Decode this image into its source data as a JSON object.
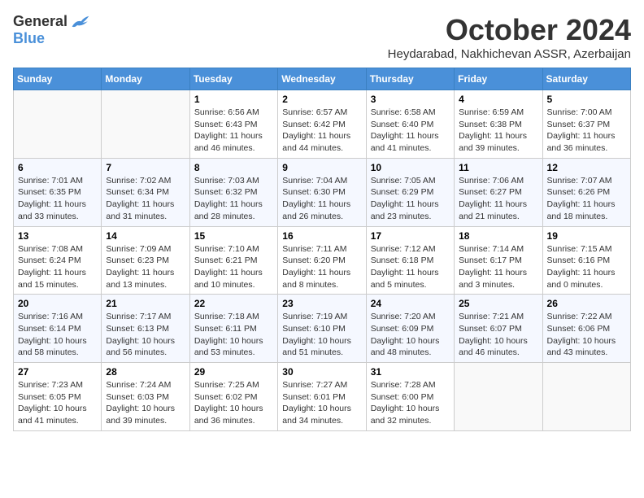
{
  "logo": {
    "general": "General",
    "blue": "Blue"
  },
  "title": "October 2024",
  "location": "Heydarabad, Nakhichevan ASSR, Azerbaijan",
  "headers": [
    "Sunday",
    "Monday",
    "Tuesday",
    "Wednesday",
    "Thursday",
    "Friday",
    "Saturday"
  ],
  "weeks": [
    [
      {
        "day": "",
        "sunrise": "",
        "sunset": "",
        "daylight": ""
      },
      {
        "day": "",
        "sunrise": "",
        "sunset": "",
        "daylight": ""
      },
      {
        "day": "1",
        "sunrise": "Sunrise: 6:56 AM",
        "sunset": "Sunset: 6:43 PM",
        "daylight": "Daylight: 11 hours and 46 minutes."
      },
      {
        "day": "2",
        "sunrise": "Sunrise: 6:57 AM",
        "sunset": "Sunset: 6:42 PM",
        "daylight": "Daylight: 11 hours and 44 minutes."
      },
      {
        "day": "3",
        "sunrise": "Sunrise: 6:58 AM",
        "sunset": "Sunset: 6:40 PM",
        "daylight": "Daylight: 11 hours and 41 minutes."
      },
      {
        "day": "4",
        "sunrise": "Sunrise: 6:59 AM",
        "sunset": "Sunset: 6:38 PM",
        "daylight": "Daylight: 11 hours and 39 minutes."
      },
      {
        "day": "5",
        "sunrise": "Sunrise: 7:00 AM",
        "sunset": "Sunset: 6:37 PM",
        "daylight": "Daylight: 11 hours and 36 minutes."
      }
    ],
    [
      {
        "day": "6",
        "sunrise": "Sunrise: 7:01 AM",
        "sunset": "Sunset: 6:35 PM",
        "daylight": "Daylight: 11 hours and 33 minutes."
      },
      {
        "day": "7",
        "sunrise": "Sunrise: 7:02 AM",
        "sunset": "Sunset: 6:34 PM",
        "daylight": "Daylight: 11 hours and 31 minutes."
      },
      {
        "day": "8",
        "sunrise": "Sunrise: 7:03 AM",
        "sunset": "Sunset: 6:32 PM",
        "daylight": "Daylight: 11 hours and 28 minutes."
      },
      {
        "day": "9",
        "sunrise": "Sunrise: 7:04 AM",
        "sunset": "Sunset: 6:30 PM",
        "daylight": "Daylight: 11 hours and 26 minutes."
      },
      {
        "day": "10",
        "sunrise": "Sunrise: 7:05 AM",
        "sunset": "Sunset: 6:29 PM",
        "daylight": "Daylight: 11 hours and 23 minutes."
      },
      {
        "day": "11",
        "sunrise": "Sunrise: 7:06 AM",
        "sunset": "Sunset: 6:27 PM",
        "daylight": "Daylight: 11 hours and 21 minutes."
      },
      {
        "day": "12",
        "sunrise": "Sunrise: 7:07 AM",
        "sunset": "Sunset: 6:26 PM",
        "daylight": "Daylight: 11 hours and 18 minutes."
      }
    ],
    [
      {
        "day": "13",
        "sunrise": "Sunrise: 7:08 AM",
        "sunset": "Sunset: 6:24 PM",
        "daylight": "Daylight: 11 hours and 15 minutes."
      },
      {
        "day": "14",
        "sunrise": "Sunrise: 7:09 AM",
        "sunset": "Sunset: 6:23 PM",
        "daylight": "Daylight: 11 hours and 13 minutes."
      },
      {
        "day": "15",
        "sunrise": "Sunrise: 7:10 AM",
        "sunset": "Sunset: 6:21 PM",
        "daylight": "Daylight: 11 hours and 10 minutes."
      },
      {
        "day": "16",
        "sunrise": "Sunrise: 7:11 AM",
        "sunset": "Sunset: 6:20 PM",
        "daylight": "Daylight: 11 hours and 8 minutes."
      },
      {
        "day": "17",
        "sunrise": "Sunrise: 7:12 AM",
        "sunset": "Sunset: 6:18 PM",
        "daylight": "Daylight: 11 hours and 5 minutes."
      },
      {
        "day": "18",
        "sunrise": "Sunrise: 7:14 AM",
        "sunset": "Sunset: 6:17 PM",
        "daylight": "Daylight: 11 hours and 3 minutes."
      },
      {
        "day": "19",
        "sunrise": "Sunrise: 7:15 AM",
        "sunset": "Sunset: 6:16 PM",
        "daylight": "Daylight: 11 hours and 0 minutes."
      }
    ],
    [
      {
        "day": "20",
        "sunrise": "Sunrise: 7:16 AM",
        "sunset": "Sunset: 6:14 PM",
        "daylight": "Daylight: 10 hours and 58 minutes."
      },
      {
        "day": "21",
        "sunrise": "Sunrise: 7:17 AM",
        "sunset": "Sunset: 6:13 PM",
        "daylight": "Daylight: 10 hours and 56 minutes."
      },
      {
        "day": "22",
        "sunrise": "Sunrise: 7:18 AM",
        "sunset": "Sunset: 6:11 PM",
        "daylight": "Daylight: 10 hours and 53 minutes."
      },
      {
        "day": "23",
        "sunrise": "Sunrise: 7:19 AM",
        "sunset": "Sunset: 6:10 PM",
        "daylight": "Daylight: 10 hours and 51 minutes."
      },
      {
        "day": "24",
        "sunrise": "Sunrise: 7:20 AM",
        "sunset": "Sunset: 6:09 PM",
        "daylight": "Daylight: 10 hours and 48 minutes."
      },
      {
        "day": "25",
        "sunrise": "Sunrise: 7:21 AM",
        "sunset": "Sunset: 6:07 PM",
        "daylight": "Daylight: 10 hours and 46 minutes."
      },
      {
        "day": "26",
        "sunrise": "Sunrise: 7:22 AM",
        "sunset": "Sunset: 6:06 PM",
        "daylight": "Daylight: 10 hours and 43 minutes."
      }
    ],
    [
      {
        "day": "27",
        "sunrise": "Sunrise: 7:23 AM",
        "sunset": "Sunset: 6:05 PM",
        "daylight": "Daylight: 10 hours and 41 minutes."
      },
      {
        "day": "28",
        "sunrise": "Sunrise: 7:24 AM",
        "sunset": "Sunset: 6:03 PM",
        "daylight": "Daylight: 10 hours and 39 minutes."
      },
      {
        "day": "29",
        "sunrise": "Sunrise: 7:25 AM",
        "sunset": "Sunset: 6:02 PM",
        "daylight": "Daylight: 10 hours and 36 minutes."
      },
      {
        "day": "30",
        "sunrise": "Sunrise: 7:27 AM",
        "sunset": "Sunset: 6:01 PM",
        "daylight": "Daylight: 10 hours and 34 minutes."
      },
      {
        "day": "31",
        "sunrise": "Sunrise: 7:28 AM",
        "sunset": "Sunset: 6:00 PM",
        "daylight": "Daylight: 10 hours and 32 minutes."
      },
      {
        "day": "",
        "sunrise": "",
        "sunset": "",
        "daylight": ""
      },
      {
        "day": "",
        "sunrise": "",
        "sunset": "",
        "daylight": ""
      }
    ]
  ]
}
